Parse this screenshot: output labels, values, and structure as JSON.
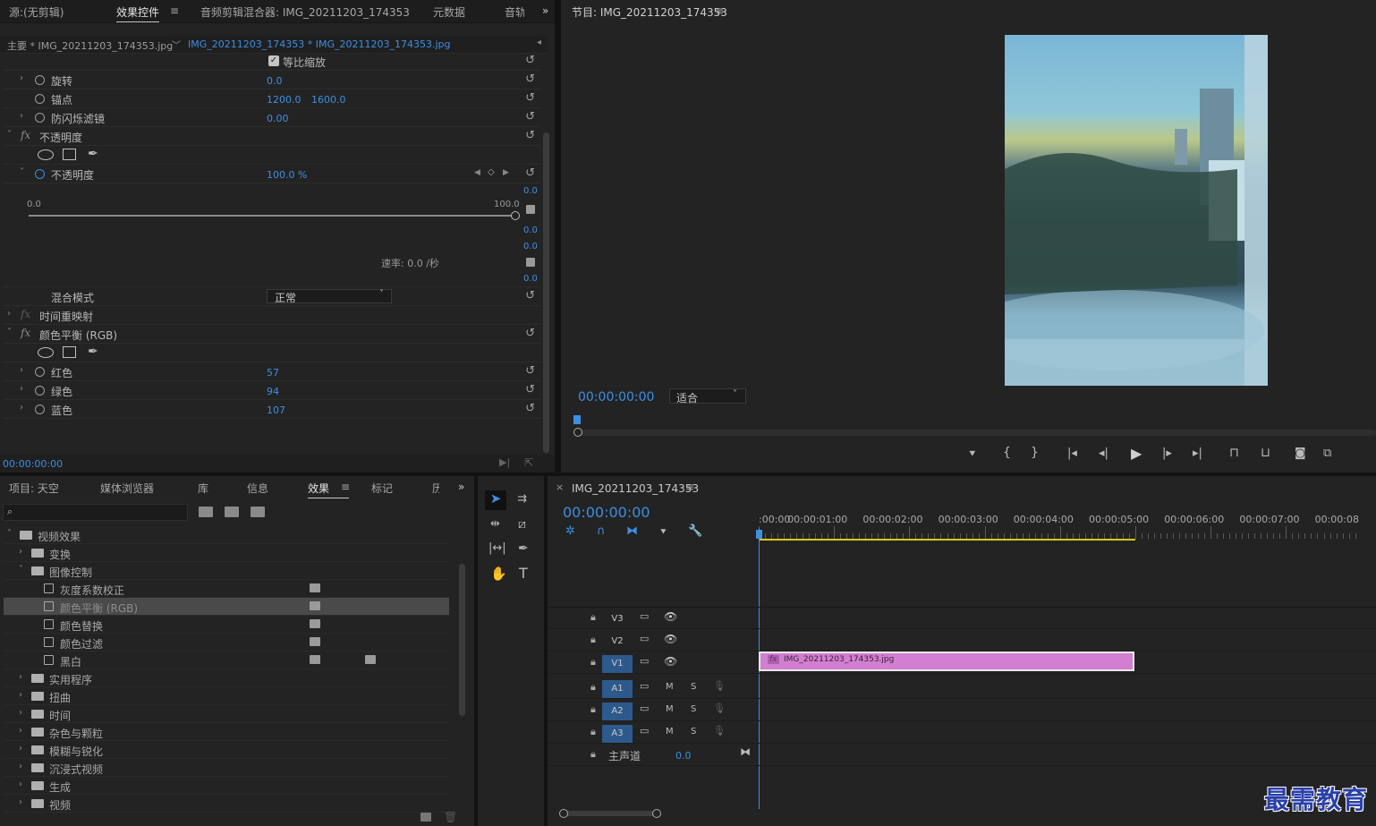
{
  "source_panel": {
    "tabs": [
      "源:(无剪辑)",
      "效果控件",
      "音频剪辑混合器: IMG_20211203_174353",
      "元数据",
      "音轨"
    ],
    "clip_tab_main": "主要 * IMG_20211203_174353.jpg",
    "clip_tab_seq": "IMG_20211203_174353 * IMG_20211203_174353.jpg"
  },
  "effect_controls": {
    "uniform_scale": "等比缩放",
    "rotation": {
      "label": "旋转",
      "value": "0.0"
    },
    "anchor": {
      "label": "锚点",
      "x": "1200.0",
      "y": "1600.0"
    },
    "flicker": {
      "label": "防闪烁滤镜",
      "value": "0.00"
    },
    "opacity_section": "不透明度",
    "opacity": {
      "label": "不透明度",
      "value": "100.0 %"
    },
    "graph": {
      "min": "0.0",
      "max": "100.0",
      "right_vals": [
        "0.0",
        "0.0",
        "0.0",
        "0.0"
      ],
      "rate": "速率: 0.0 /秒"
    },
    "blend": {
      "label": "混合模式",
      "value": "正常"
    },
    "time_remap": "时间重映射",
    "color_balance": "颜色平衡 (RGB)",
    "red": {
      "label": "红色",
      "value": "57"
    },
    "green": {
      "label": "绿色",
      "value": "94"
    },
    "blue": {
      "label": "蓝色",
      "value": "107"
    },
    "timecode": "00:00:00:00"
  },
  "program": {
    "title": "节目: IMG_20211203_174353",
    "timecode": "00:00:00:00",
    "fit": "适合"
  },
  "project_panel": {
    "tabs": [
      "项目: 天空",
      "媒体浏览器",
      "库",
      "信息",
      "效果",
      "标记",
      "历"
    ],
    "tree": [
      {
        "label": "视频效果",
        "level": 0,
        "type": "folder",
        "open": true
      },
      {
        "label": "变换",
        "level": 1,
        "type": "folder"
      },
      {
        "label": "图像控制",
        "level": 1,
        "type": "folder",
        "open": true
      },
      {
        "label": "灰度系数校正",
        "level": 2,
        "type": "fx"
      },
      {
        "label": "颜色平衡 (RGB)",
        "level": 2,
        "type": "fx",
        "selected": true
      },
      {
        "label": "颜色替换",
        "level": 2,
        "type": "fx"
      },
      {
        "label": "颜色过滤",
        "level": 2,
        "type": "fx"
      },
      {
        "label": "黑白",
        "level": 2,
        "type": "fx"
      },
      {
        "label": "实用程序",
        "level": 1,
        "type": "folder"
      },
      {
        "label": "扭曲",
        "level": 1,
        "type": "folder"
      },
      {
        "label": "时间",
        "level": 1,
        "type": "folder"
      },
      {
        "label": "杂色与颗粒",
        "level": 1,
        "type": "folder"
      },
      {
        "label": "模糊与锐化",
        "level": 1,
        "type": "folder"
      },
      {
        "label": "沉浸式视频",
        "level": 1,
        "type": "folder"
      },
      {
        "label": "生成",
        "level": 1,
        "type": "folder"
      },
      {
        "label": "视频",
        "level": 1,
        "type": "folder"
      }
    ]
  },
  "timeline": {
    "title": "IMG_20211203_174353",
    "timecode": "00:00:00:00",
    "ruler": [
      ":00:00",
      "00:00:01:00",
      "00:00:02:00",
      "00:00:03:00",
      "00:00:04:00",
      "00:00:05:00",
      "00:00:06:00",
      "00:00:07:00",
      "00:00:08"
    ],
    "tracks_video": [
      "V3",
      "V2",
      "V1"
    ],
    "tracks_audio": [
      "A1",
      "A2",
      "A3"
    ],
    "mute": "M",
    "solo": "S",
    "master": {
      "label": "主声道",
      "value": "0.0"
    },
    "clip": "IMG_20211203_174353.jpg"
  },
  "watermark": "最需教育"
}
